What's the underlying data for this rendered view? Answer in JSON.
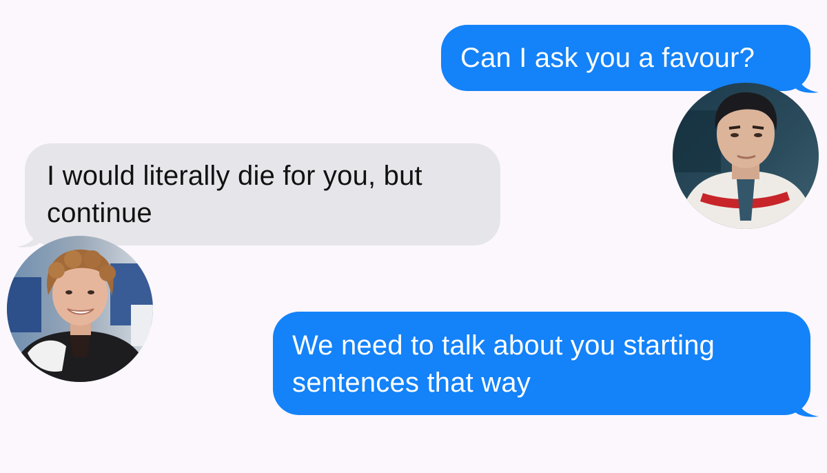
{
  "conversation": {
    "messages": [
      {
        "direction": "sent",
        "text": "Can I ask you a favour?"
      },
      {
        "direction": "received",
        "text": "I would literally die for you, but continue"
      },
      {
        "direction": "sent",
        "text": "We need to talk about you starting sentences that way"
      }
    ]
  },
  "colors": {
    "background": "#fcf7fc",
    "sent_bubble": "#1482f8",
    "received_bubble": "#e6e5ea",
    "sent_text": "#ffffff",
    "received_text": "#111111"
  },
  "avatars": {
    "right": {
      "icon": "avatar-photo-dark-hair-white-jacket"
    },
    "left": {
      "icon": "avatar-photo-curly-hair-smiling"
    }
  }
}
